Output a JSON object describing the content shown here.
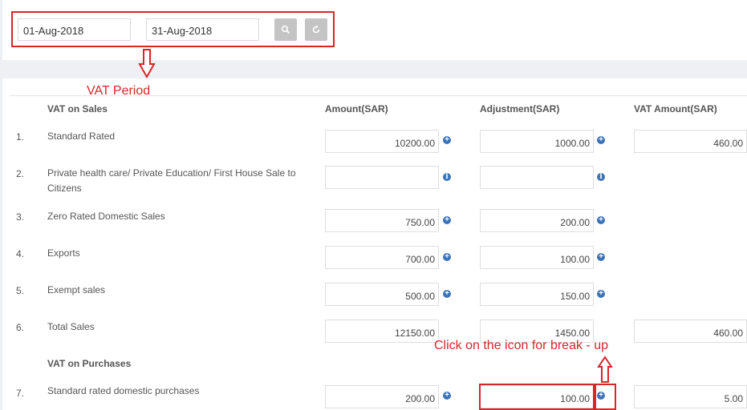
{
  "filter": {
    "from_date": "01-Aug-2018",
    "to_date": "31-Aug-2018",
    "search_icon": "search-icon",
    "refresh_icon": "refresh-icon"
  },
  "annotations": {
    "vat_period": "VAT Period",
    "breakup_hint": "Click on the icon for break - up"
  },
  "table": {
    "headers": {
      "sales_section": "VAT on Sales",
      "amount": "Amount(SAR)",
      "adjustment": "Adjustment(SAR)",
      "vat_amount": "VAT Amount(SAR)",
      "purchases_section": "VAT on Purchases"
    },
    "rows": [
      {
        "num": "1.",
        "label": "Standard Rated",
        "amount": "10200.00",
        "adjustment": "1000.00",
        "vat": "460.00",
        "icon": "plus-circle-icon"
      },
      {
        "num": "2.",
        "label": "Private health care/ Private Education/ First House Sale to Citizens",
        "amount": "",
        "adjustment": "",
        "vat": "",
        "icon": "info-circle-icon"
      },
      {
        "num": "3.",
        "label": "Zero Rated Domestic Sales",
        "amount": "750.00",
        "adjustment": "200.00",
        "vat": "",
        "icon": "plus-circle-icon"
      },
      {
        "num": "4.",
        "label": "Exports",
        "amount": "700.00",
        "adjustment": "100.00",
        "vat": "",
        "icon": "plus-circle-icon"
      },
      {
        "num": "5.",
        "label": "Exempt sales",
        "amount": "500.00",
        "adjustment": "150.00",
        "vat": "",
        "icon": "plus-circle-icon"
      },
      {
        "num": "6.",
        "label": "Total Sales",
        "amount": "12150.00",
        "adjustment": "1450.00",
        "vat": "460.00",
        "icon": ""
      },
      {
        "num": "7.",
        "label": "Standard rated domestic purchases",
        "amount": "200.00",
        "adjustment": "100.00",
        "vat": "5.00",
        "icon": "plus-circle-icon"
      }
    ]
  },
  "colors": {
    "annotation_red": "#d9252a",
    "icon_blue": "#3b73b9"
  }
}
